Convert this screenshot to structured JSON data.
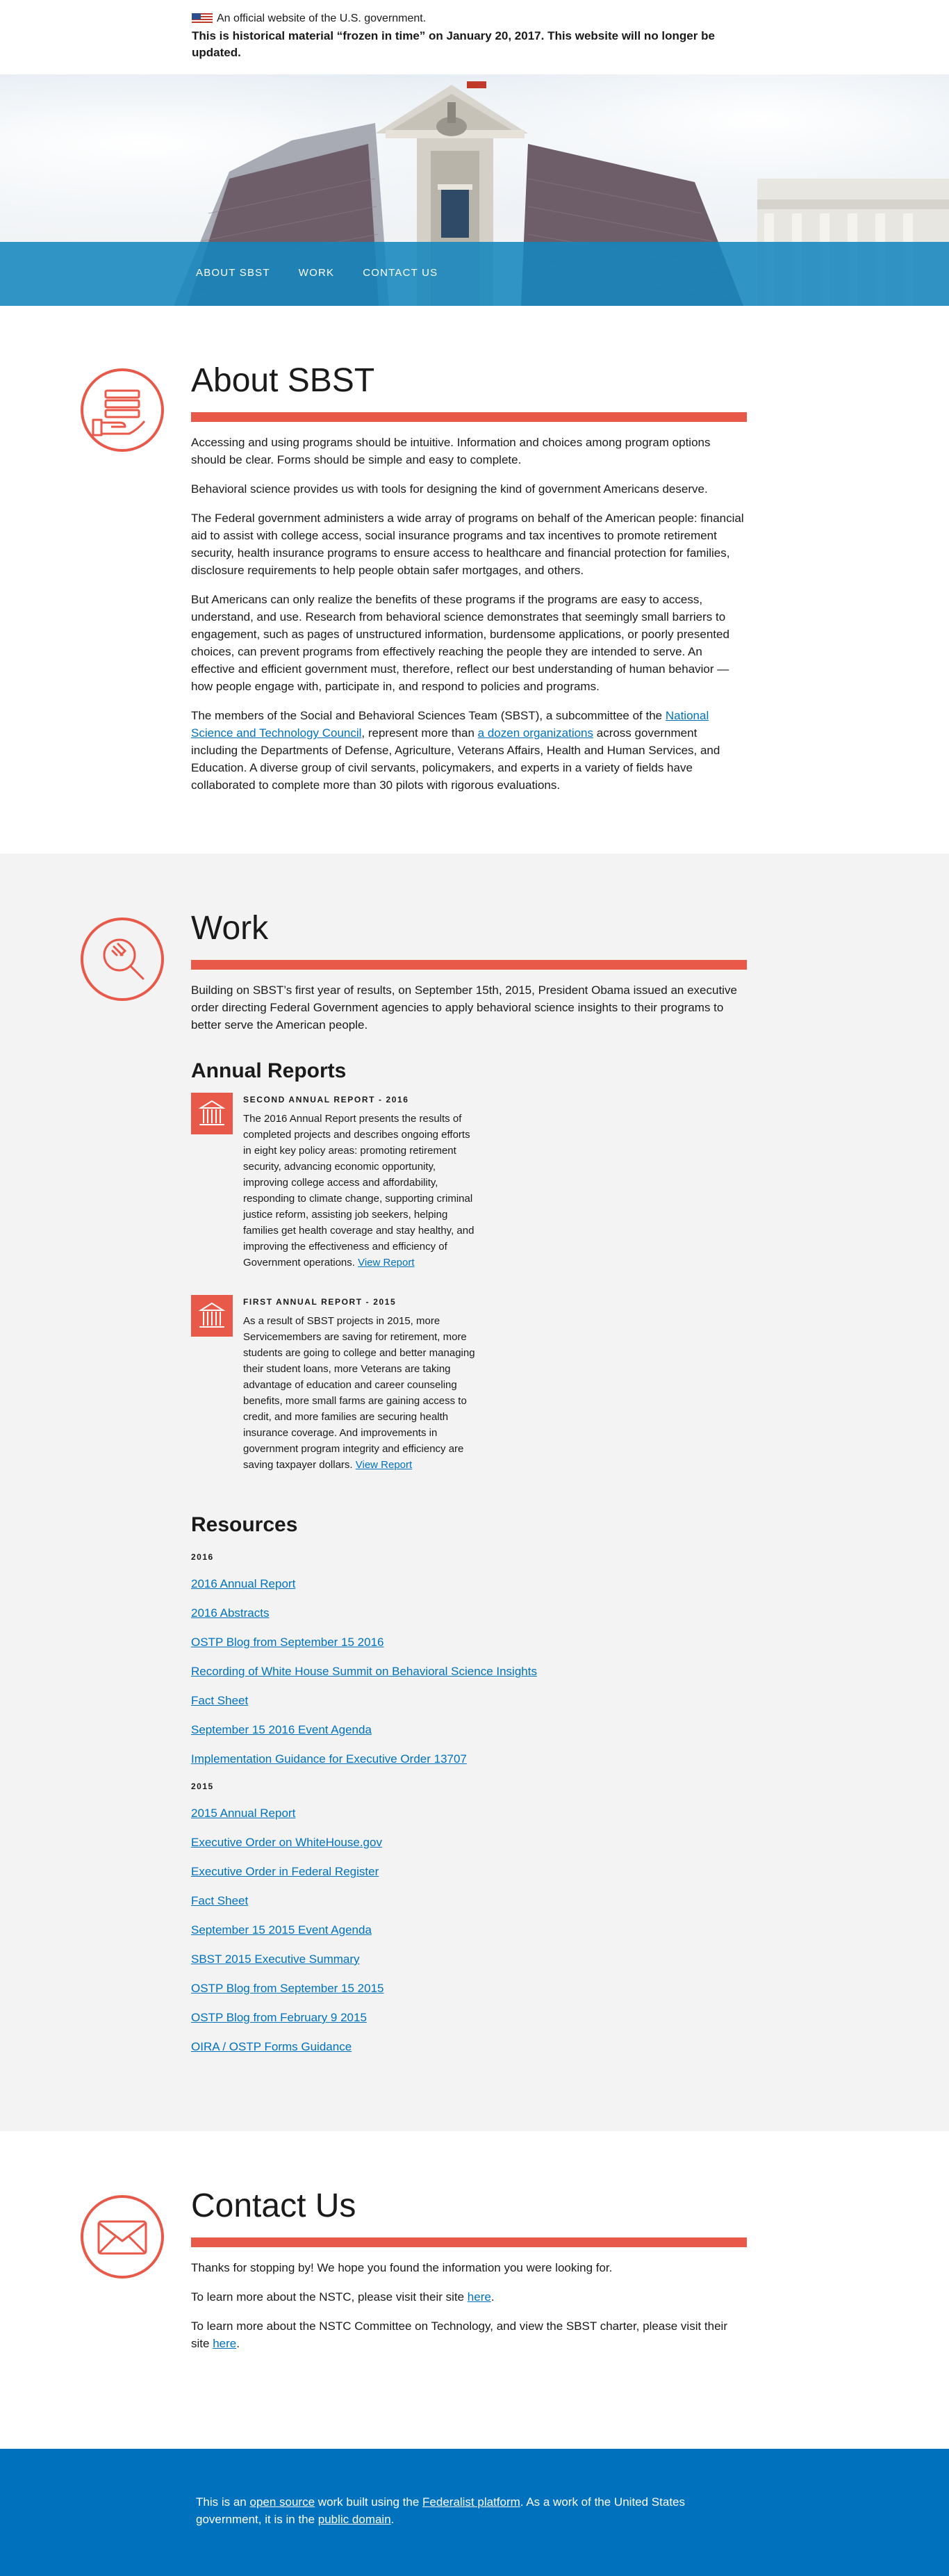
{
  "banner": {
    "official_text": "An official website of the U.S. government.",
    "historical_text": "This is historical material “frozen in time” on January 20, 2017. This website will no longer be updated."
  },
  "nav": {
    "items": [
      "ABOUT SBST",
      "WORK",
      "CONTACT US"
    ]
  },
  "about": {
    "title": "About SBST",
    "icon": "hand-with-documents-icon",
    "p1": "Accessing and using programs should be intuitive. Information and choices among program options should be clear. Forms should be simple and easy to complete.",
    "p2": "Behavioral science provides us with tools for designing the kind of government Americans deserve.",
    "p3": "The Federal government administers a wide array of programs on behalf of the American people: financial aid to assist with college access, social insurance programs and tax incentives to promote retirement security, health insurance programs to ensure access to healthcare and financial protection for families, disclosure requirements to help people obtain safer mortgages, and others.",
    "p4": "But Americans can only realize the benefits of these programs if the programs are easy to access, understand, and use. Research from behavioral science demonstrates that seemingly small barriers to engagement, such as pages of unstructured information, burdensome applications, or poorly presented choices, can prevent programs from effectively reaching the people they are intended to serve. An effective and efficient government must, therefore, reflect our best understanding of human behavior — how people engage with, participate in, and respond to policies and programs.",
    "p5": {
      "before": "The members of the Social and Behavioral Sciences Team (SBST), a subcommittee of the ",
      "link1": "National Science and Technology Council",
      "mid": ", represent more than ",
      "link2": "a dozen organizations",
      "after": " across government including the Departments of Defense, Agriculture, Veterans Affairs, Health and Human Services, and Education. A diverse group of civil servants, policymakers, and experts in a variety of fields have collaborated to complete more than 30 pilots with rigorous evaluations."
    }
  },
  "work": {
    "title": "Work",
    "icon": "magnifier-with-wrench-icon",
    "intro": "Building on SBST’s first year of results, on September 15th, 2015, President Obama issued an executive order directing Federal Government agencies to apply behavioral science insights to their programs to better serve the American people.",
    "reports_heading": "Annual Reports",
    "reports": [
      {
        "title": "SECOND ANNUAL REPORT - 2016",
        "text": "The 2016 Annual Report presents the results of completed projects and describes ongoing efforts in eight key policy areas: promoting retirement security, advancing economic opportunity, improving college access and affordability, responding to climate change, supporting criminal justice reform, assisting job seekers, helping families get health coverage and stay healthy, and improving the effectiveness and efficiency of Government operations. ",
        "link": "View Report"
      },
      {
        "title": "FIRST ANNUAL REPORT - 2015",
        "text": "As a result of SBST projects in 2015, more Servicemembers are saving for retirement, more students are going to college and better managing their student loans, more Veterans are taking advantage of education and career counseling benefits, more small farms are gaining access to credit, and more families are securing health insurance coverage. And improvements in government program integrity and efficiency are saving taxpayer dollars. ",
        "link": "View Report"
      }
    ],
    "resources_heading": "Resources",
    "year_2016": "2016",
    "links_2016": [
      "2016 Annual Report",
      "2016 Abstracts",
      "OSTP Blog from September 15 2016",
      "Recording of White House Summit on Behavioral Science Insights",
      "Fact Sheet",
      "September 15 2016 Event Agenda",
      "Implementation Guidance for Executive Order 13707"
    ],
    "year_2015": "2015",
    "links_2015": [
      "2015 Annual Report",
      "Executive Order on WhiteHouse.gov",
      "Executive Order in Federal Register",
      "Fact Sheet",
      "September 15 2015 Event Agenda",
      "SBST 2015 Executive Summary",
      "OSTP Blog from September 15 2015",
      "OSTP Blog from February 9 2015",
      "OIRA / OSTP Forms Guidance"
    ]
  },
  "contact": {
    "title": "Contact Us",
    "icon": "envelope-icon",
    "p1": "Thanks for stopping by! We hope you found the information you were looking for.",
    "p2_before": "To learn more about the NSTC, please visit their site ",
    "p2_link": "here",
    "p2_after": ".",
    "p3_before": "To learn more about the NSTC Committee on Technology, and view the SBST charter, please visit their site ",
    "p3_link": "here",
    "p3_after": "."
  },
  "footer": {
    "t1": "This is an ",
    "l1": "open source",
    "t2": " work built using the ",
    "l2": "Federalist platform",
    "t3": ". As a work of the United States government, it is in the ",
    "l3": "public domain",
    "t4": "."
  },
  "colors": {
    "accent_red": "#e8594a",
    "nav_blue": "#1486be",
    "footer_blue": "#0071bc",
    "link_blue": "#0071bc"
  }
}
